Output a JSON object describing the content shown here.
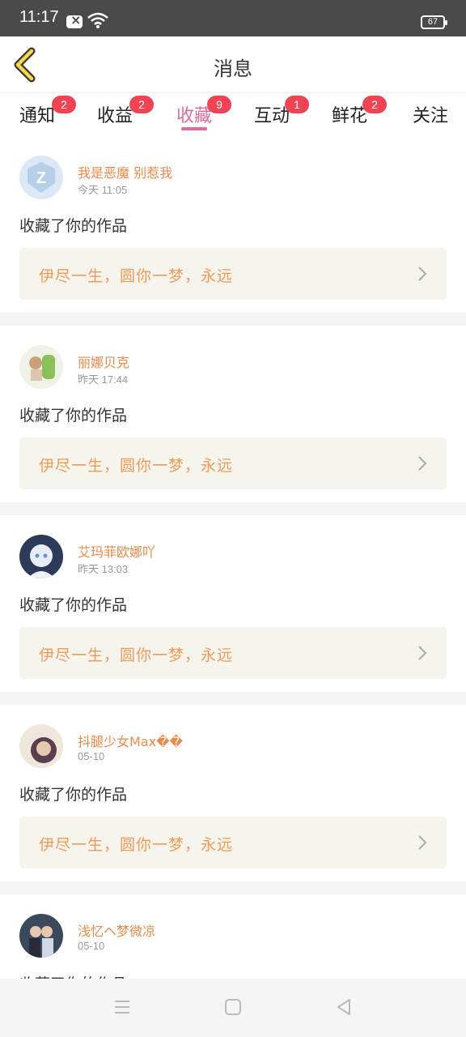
{
  "status_bar": {
    "time": "11:17",
    "battery": "67",
    "icons": [
      "notification-icon",
      "wifi-icon",
      "battery-icon"
    ]
  },
  "header": {
    "title": "消息",
    "back_icon": "chevron-left-icon"
  },
  "tabs": [
    {
      "label": "通知",
      "badge": "2"
    },
    {
      "label": "收益",
      "badge": "2"
    },
    {
      "label": "收藏",
      "badge": "9"
    },
    {
      "label": "互动",
      "badge": "1"
    },
    {
      "label": "鲜花",
      "badge": "2"
    },
    {
      "label": "关注",
      "badge": ""
    }
  ],
  "active_tab": "收藏",
  "colors": {
    "accent": "#d96ba0",
    "username": "#e88a4c",
    "work_title": "#f09a5a",
    "badge": "#f04455",
    "work_box_bg": "#f5f5ee"
  },
  "messages": [
    {
      "user": "我是恶魔 别惹我",
      "time": "今天 11:05",
      "action": "收藏了你的作品",
      "work": "伊尽一生，圆你一梦，永远"
    },
    {
      "user": "丽娜贝克",
      "time": "昨天 17:44",
      "action": "收藏了你的作品",
      "work": "伊尽一生，圆你一梦，永远"
    },
    {
      "user": "艾玛菲欧娜吖",
      "time": "昨天 13:03",
      "action": "收藏了你的作品",
      "work": "伊尽一生，圆你一梦，永远"
    },
    {
      "user": "抖腿少女Max��",
      "time": "05-10",
      "action": "收藏了你的作品",
      "work": "伊尽一生，圆你一梦，永远"
    },
    {
      "user": "浅忆ヘ梦微凉",
      "time": "05-10",
      "action": "收藏了你的作品",
      "work": ""
    }
  ],
  "nav_bar": [
    "menu-icon",
    "home-icon",
    "back-triangle-icon"
  ]
}
